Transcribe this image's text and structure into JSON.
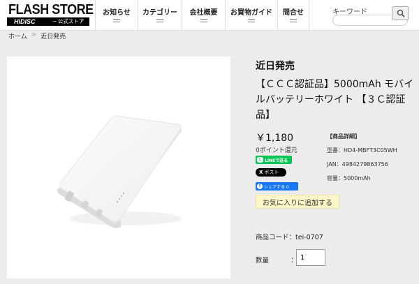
{
  "logo": {
    "main": "FLASH STORE",
    "brand": "HIDISC",
    "sub": "─ 公式ストア"
  },
  "nav": [
    "お知らせ",
    "カテゴリー",
    "会社概要",
    "お買物ガイド",
    "問合せ"
  ],
  "search": {
    "label": "キーワード",
    "value": "",
    "icon": "search-icon"
  },
  "breadcrumb": {
    "home": "ホーム",
    "sep": ">",
    "current": "近日発売"
  },
  "product": {
    "status": "近日発売",
    "title": "【ＣＣＣ認証品】5000mAh モバイルバッテリーホワイト 【３Ｃ認証品】",
    "price": "￥1,180",
    "points": "0ポイント還元",
    "share": {
      "line": "LINEで送る",
      "x_icon": "X",
      "x": "ポスト",
      "fb_icon": "f",
      "fb": "シェアする 0"
    },
    "favorite": "お気に入りに追加する",
    "details": {
      "heading": "【商品詳細】",
      "model": "型番：HD4-MBFT3C05WH",
      "jan": "JAN：4984279863756",
      "capacity": "容量：5000mAh"
    },
    "code_label": "商品コード：tei-0707",
    "qty_label": "数量",
    "qty_colon": "：",
    "qty_value": "1"
  },
  "colors": {
    "line": "#06c755",
    "facebook": "#1877f2",
    "favorite_bg": "#fdf6c9"
  }
}
